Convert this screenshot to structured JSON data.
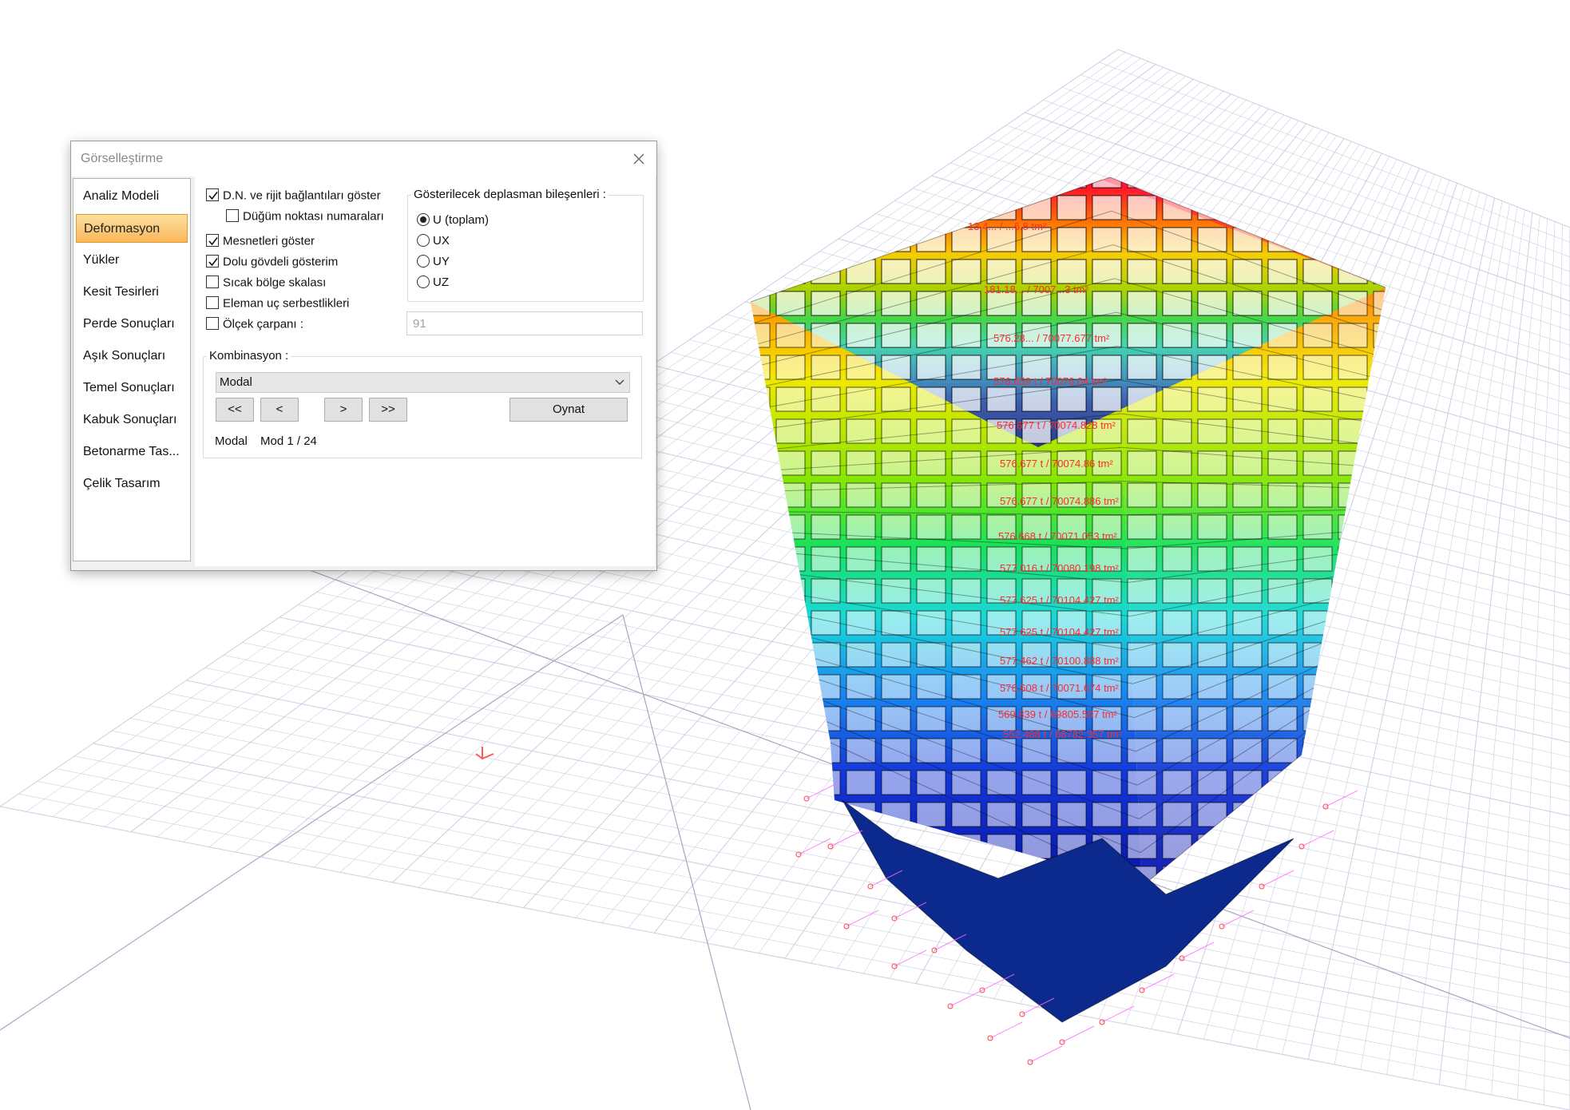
{
  "dialog": {
    "title": "Görselleştirme",
    "nav_items": [
      {
        "label": "Analiz Modeli"
      },
      {
        "label": "Deformasyon"
      },
      {
        "label": "Yükler"
      },
      {
        "label": "Kesit Tesirleri"
      },
      {
        "label": "Perde Sonuçları"
      },
      {
        "label": "Aşık Sonuçları"
      },
      {
        "label": "Temel Sonuçları"
      },
      {
        "label": "Kabuk Sonuçları"
      },
      {
        "label": "Betonarme Tas..."
      },
      {
        "label": "Çelik Tasarım"
      }
    ],
    "active_nav": "Deformasyon",
    "checkboxes": [
      {
        "label": "D.N. ve rijit bağlantıları göster",
        "checked": true
      },
      {
        "label": "Düğüm noktası numaraları",
        "checked": false
      },
      {
        "label": "Mesnetleri göster",
        "checked": true
      },
      {
        "label": "Dolu gövdeli gösterim",
        "checked": true
      },
      {
        "label": "Sıcak bölge skalası",
        "checked": false
      },
      {
        "label": "Eleman uç serbestlikleri",
        "checked": false
      },
      {
        "label": "Ölçek çarpanı :",
        "checked": false
      }
    ],
    "scale_factor": "91",
    "displacement_group": {
      "title": "Gösterilecek deplasman bileşenleri :",
      "options": [
        {
          "label": "U (toplam)",
          "selected": true
        },
        {
          "label": "UX",
          "selected": false
        },
        {
          "label": "UY",
          "selected": false
        },
        {
          "label": "UZ",
          "selected": false
        }
      ]
    },
    "combination_group": {
      "title": "Kombinasyon :",
      "selected": "Modal",
      "buttons": {
        "first": "<<",
        "prev": "<",
        "next": ">",
        "last": ">>",
        "play": "Oynat"
      },
      "status_type": "Modal",
      "status_mode": "Mod 1 / 24"
    }
  },
  "viewport": {
    "storey_labels": [
      "13.4... / ...6.8 tm²",
      "181.18... / 7007...3 tm²",
      "576.28... / 70077.677 tm²",
      "576.659 t / 70076.04 tm²",
      "576.677 t / 70074.828 tm²",
      "576.677 t / 70074.86 tm²",
      "576.677 t / 70074.886 tm²",
      "576.668 t / 70071.053 tm²",
      "577.016 t / 70080.198 tm²",
      "577.625 t / 70104.427 tm²",
      "577.625 t / 70104.427 tm²",
      "577.462 t / 70100.888 tm²",
      "576.608 t / 70071.674 tm²",
      "569.839 t / 69805.587 tm²",
      "552.488 t / 68782.357 tm²"
    ],
    "colors": {
      "label_red": "#ff2a2a",
      "grid": "#c8c8e0",
      "axis_red": "#ff5a5a",
      "support_magenta": "#ff66ff",
      "accent_orange": "#f9b657"
    }
  }
}
